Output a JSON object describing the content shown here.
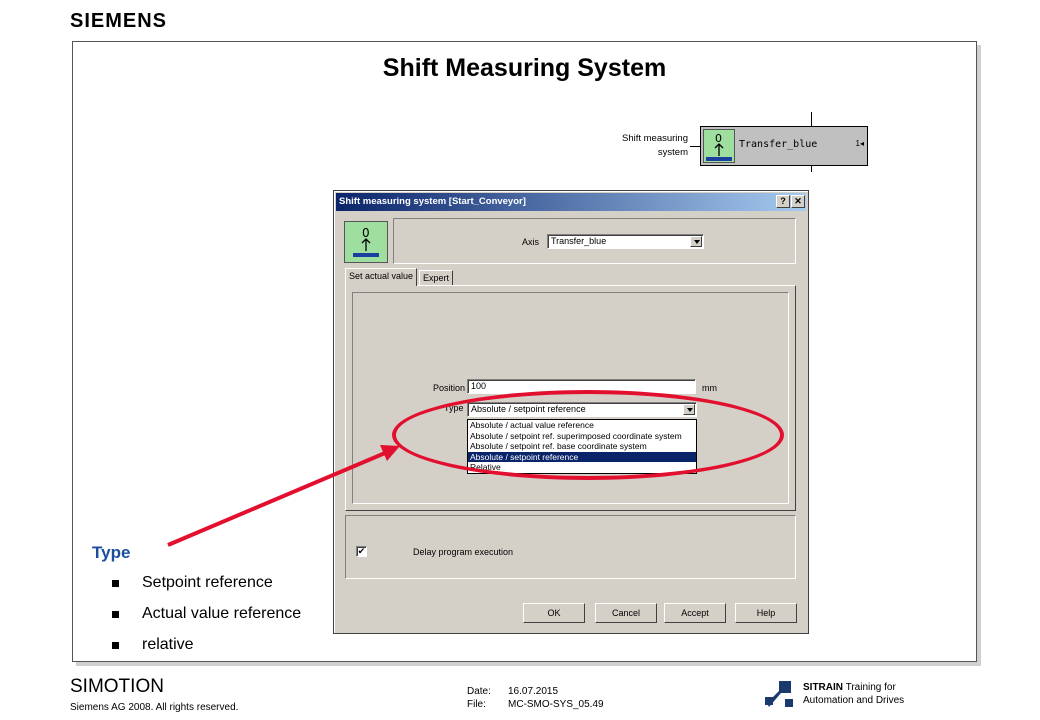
{
  "slide": {
    "brand": "SIEMENS",
    "title": "Shift Measuring System"
  },
  "block": {
    "label_line1": "Shift measuring",
    "label_line2": "system",
    "icon_glyph": "0",
    "name": "Transfer_blue",
    "tag": "1◂"
  },
  "dialog": {
    "title": "Shift measuring system [Start_Conveyor]",
    "help_btn": "?",
    "close_btn": "✕",
    "icon_glyph": "0",
    "axis_label": "Axis",
    "axis_value": "Transfer_blue",
    "tabs": [
      "Set actual value",
      "Expert"
    ],
    "position_label": "Position",
    "position_value": "100",
    "position_unit": "mm",
    "type_label": "Type",
    "type_value": "Absolute / setpoint reference",
    "type_options": [
      "Absolute / actual value reference",
      "Absolute / setpoint ref. superimposed coordinate system",
      "Absolute / setpoint ref. base coordinate system",
      "Absolute / setpoint reference",
      "Relative"
    ],
    "delay_checked": "✔",
    "delay_label": "Delay program execution",
    "buttons": {
      "ok": "OK",
      "cancel": "Cancel",
      "accept": "Accept",
      "help": "Help"
    }
  },
  "annotation": {
    "type_heading": "Type",
    "bullets": [
      "Setpoint reference",
      "Actual value reference",
      "relative"
    ],
    "highlight_color": "#e30f2f",
    "heading_color": "#1a4fa0"
  },
  "footer": {
    "product": "SIMOTION",
    "copyright": "Siemens AG 2008. All rights reserved.",
    "date_label": "Date:",
    "date_value": "16.07.2015",
    "file_label": "File:",
    "file_value": "MC-SMO-SYS_05.49",
    "sitrain": "SITRAIN",
    "sitrain_tail": "Training for",
    "sitrain_sub": "Automation and Drives"
  }
}
